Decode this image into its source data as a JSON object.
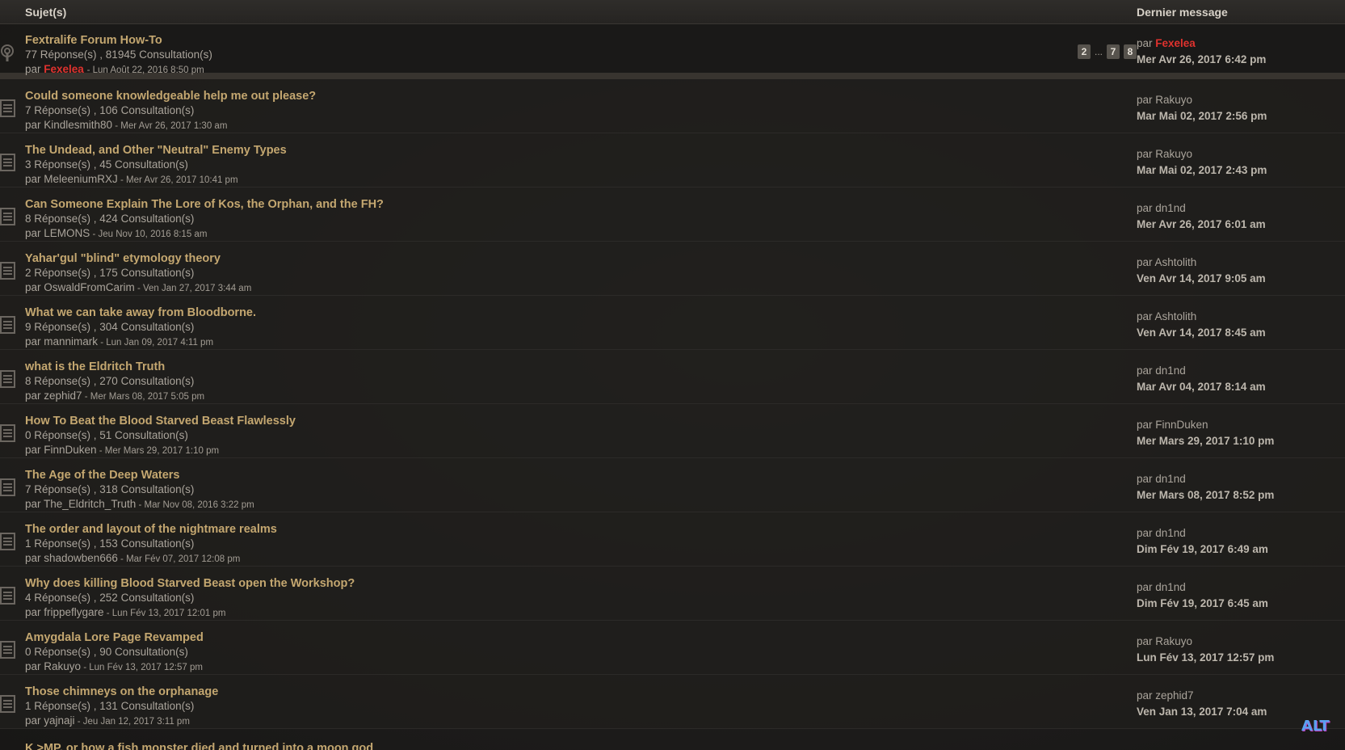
{
  "header": {
    "topics_label": "Sujet(s)",
    "last_label": "Dernier message"
  },
  "sticky": {
    "title": "Fextralife Forum How-To",
    "stats": "77 Réponse(s) , 81945 Consultation(s)",
    "by_prefix": "par",
    "author": "Fexelea",
    "date": "- Lun Août 22, 2016 8:50 pm",
    "pages": [
      "2",
      "7",
      "8"
    ],
    "ellipsis": "...",
    "last_by_prefix": "par",
    "last_author": "Fexelea",
    "last_time": "Mer Avr 26, 2017 6:42 pm"
  },
  "topics": [
    {
      "title": "Could someone knowledgeable help me out please?",
      "stats": "7 Réponse(s) , 106 Consultation(s)",
      "author": "par Kindlesmith80",
      "date": " - Mer Avr 26, 2017 1:30 am",
      "last_by": "par Rakuyo",
      "last_time": "Mar Mai 02, 2017 2:56 pm"
    },
    {
      "title": "The Undead, and Other \"Neutral\" Enemy Types",
      "stats": "3 Réponse(s) , 45 Consultation(s)",
      "author": "par MeleeniumRXJ",
      "date": " - Mer Avr 26, 2017 10:41 pm",
      "last_by": "par Rakuyo",
      "last_time": "Mar Mai 02, 2017 2:43 pm"
    },
    {
      "title": "Can Someone Explain The Lore of Kos, the Orphan, and the FH?",
      "stats": "8 Réponse(s) , 424 Consultation(s)",
      "author": "par LEMONS",
      "date": " - Jeu Nov 10, 2016 8:15 am",
      "last_by": "par dn1nd",
      "last_time": "Mer Avr 26, 2017 6:01 am"
    },
    {
      "title": "Yahar'gul \"blind\" etymology theory",
      "stats": "2 Réponse(s) , 175 Consultation(s)",
      "author": "par OswaldFromCarim",
      "date": " - Ven Jan 27, 2017 3:44 am",
      "last_by": "par Ashtolith",
      "last_time": "Ven Avr 14, 2017 9:05 am"
    },
    {
      "title": "What we can take away from Bloodborne.",
      "stats": "9 Réponse(s) , 304 Consultation(s)",
      "author": "par mannimark",
      "date": " - Lun Jan 09, 2017 4:11 pm",
      "last_by": "par Ashtolith",
      "last_time": "Ven Avr 14, 2017 8:45 am"
    },
    {
      "title": "what is the Eldritch Truth",
      "stats": "8 Réponse(s) , 270 Consultation(s)",
      "author": "par zephid7",
      "date": " - Mer Mars 08, 2017 5:05 pm",
      "last_by": "par dn1nd",
      "last_time": "Mar Avr 04, 2017 8:14 am"
    },
    {
      "title": "How To Beat the Blood Starved Beast Flawlessly",
      "stats": "0 Réponse(s) , 51 Consultation(s)",
      "author": "par FinnDuken",
      "date": " - Mer Mars 29, 2017 1:10 pm",
      "last_by": "par FinnDuken",
      "last_time": "Mer Mars 29, 2017 1:10 pm"
    },
    {
      "title": "The Age of the Deep Waters",
      "stats": "7 Réponse(s) , 318 Consultation(s)",
      "author": "par The_Eldritch_Truth",
      "date": " - Mar Nov 08, 2016 3:22 pm",
      "last_by": "par dn1nd",
      "last_time": "Mer Mars 08, 2017 8:52 pm"
    },
    {
      "title": "The order and layout of the nightmare realms",
      "stats": "1 Réponse(s) , 153 Consultation(s)",
      "author": "par shadowben666",
      "date": " - Mar Fév 07, 2017 12:08 pm",
      "last_by": "par dn1nd",
      "last_time": "Dim Fév 19, 2017 6:49 am"
    },
    {
      "title": "Why does killing Blood Starved Beast open the Workshop?",
      "stats": "4 Réponse(s) , 252 Consultation(s)",
      "author": "par frippeflygare",
      "date": " - Lun Fév 13, 2017 12:01 pm",
      "last_by": "par dn1nd",
      "last_time": "Dim Fév 19, 2017 6:45 am"
    },
    {
      "title": "Amygdala Lore Page Revamped",
      "stats": "0 Réponse(s) , 90 Consultation(s)",
      "author": "par Rakuyo",
      "date": " - Lun Fév 13, 2017 12:57 pm",
      "last_by": "par Rakuyo",
      "last_time": "Lun Fév 13, 2017 12:57 pm"
    },
    {
      "title": "Those chimneys on the orphanage",
      "stats": "1 Réponse(s) , 131 Consultation(s)",
      "author": "par yajnaji",
      "date": " - Jeu Jan 12, 2017 3:11 pm",
      "last_by": "par zephid7",
      "last_time": "Ven Jan 13, 2017 7:04 am"
    }
  ],
  "cutoff_title": "K >MP, or how a fish monster died and turned into a moon god",
  "watermark_text": "ALT",
  "colors": {
    "title": "#c4a770",
    "author_highlight": "#e0322e",
    "background": "#1c1b1a"
  },
  "icons": {
    "sticky": "announcement-icon",
    "topic": "topic-document-icon"
  }
}
